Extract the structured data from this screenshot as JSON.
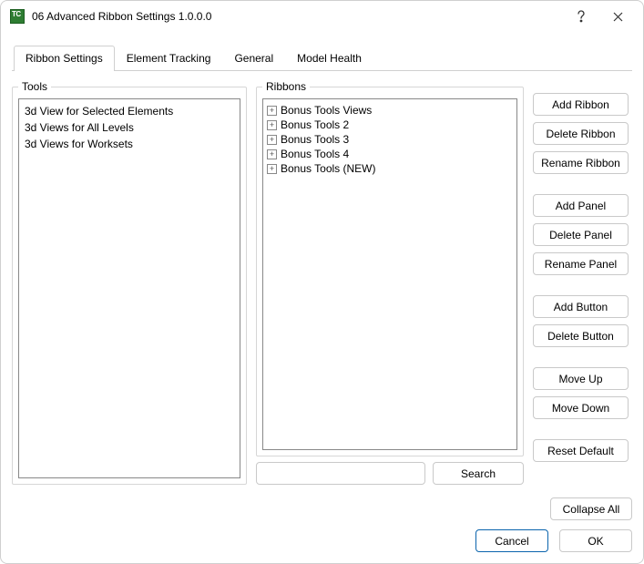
{
  "window": {
    "title": "06 Advanced Ribbon Settings 1.0.0.0"
  },
  "tabs": [
    {
      "label": "Ribbon Settings",
      "active": true
    },
    {
      "label": "Element Tracking",
      "active": false
    },
    {
      "label": "General",
      "active": false
    },
    {
      "label": "Model Health",
      "active": false
    }
  ],
  "tools": {
    "legend": "Tools",
    "items": [
      "3d View for Selected Elements",
      "3d Views for All Levels",
      "3d Views for Worksets"
    ]
  },
  "ribbons": {
    "legend": "Ribbons",
    "items": [
      "Bonus Tools Views",
      "Bonus Tools 2",
      "Bonus Tools 3",
      "Bonus Tools 4",
      "Bonus Tools (NEW)"
    ]
  },
  "side_buttons": {
    "group1": [
      "Add Ribbon",
      "Delete Ribbon",
      "Rename Ribbon"
    ],
    "group2": [
      "Add Panel",
      "Delete Panel",
      "Rename Panel"
    ],
    "group3": [
      "Add Button",
      "Delete Button"
    ],
    "group4": [
      "Move Up",
      "Move Down"
    ],
    "reset": "Reset Default"
  },
  "search": {
    "placeholder": "",
    "button": "Search"
  },
  "collapse_all": "Collapse All",
  "footer": {
    "cancel": "Cancel",
    "ok": "OK"
  }
}
